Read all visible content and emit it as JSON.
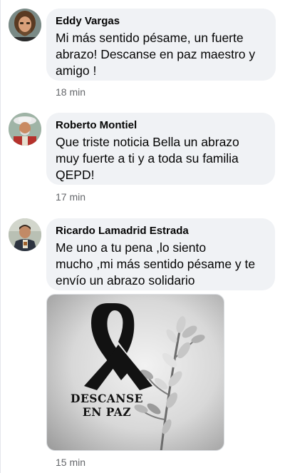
{
  "comments": [
    {
      "author": "Eddy Vargas",
      "lines": [
        "Mi más sentido pésame, un fuerte",
        "abrazo! Descanse en paz maestro y",
        "amigo !"
      ],
      "time": "18 min"
    },
    {
      "author": "Roberto Montiel",
      "lines": [
        "Que triste noticia Bella un abrazo",
        "muy fuerte a ti y a toda su familia",
        "QEPD!"
      ],
      "time": "17 min"
    },
    {
      "author": "Ricardo Lamadrid Estrada",
      "lines": [
        "Me uno a tu pena ,lo siento",
        "mucho ,mi más sentido pésame y te",
        "envío un abrazo solidario"
      ],
      "time": "15 min"
    }
  ],
  "attachment": {
    "caption_line1": "DESCANSE",
    "caption_line2": "EN PAZ"
  }
}
